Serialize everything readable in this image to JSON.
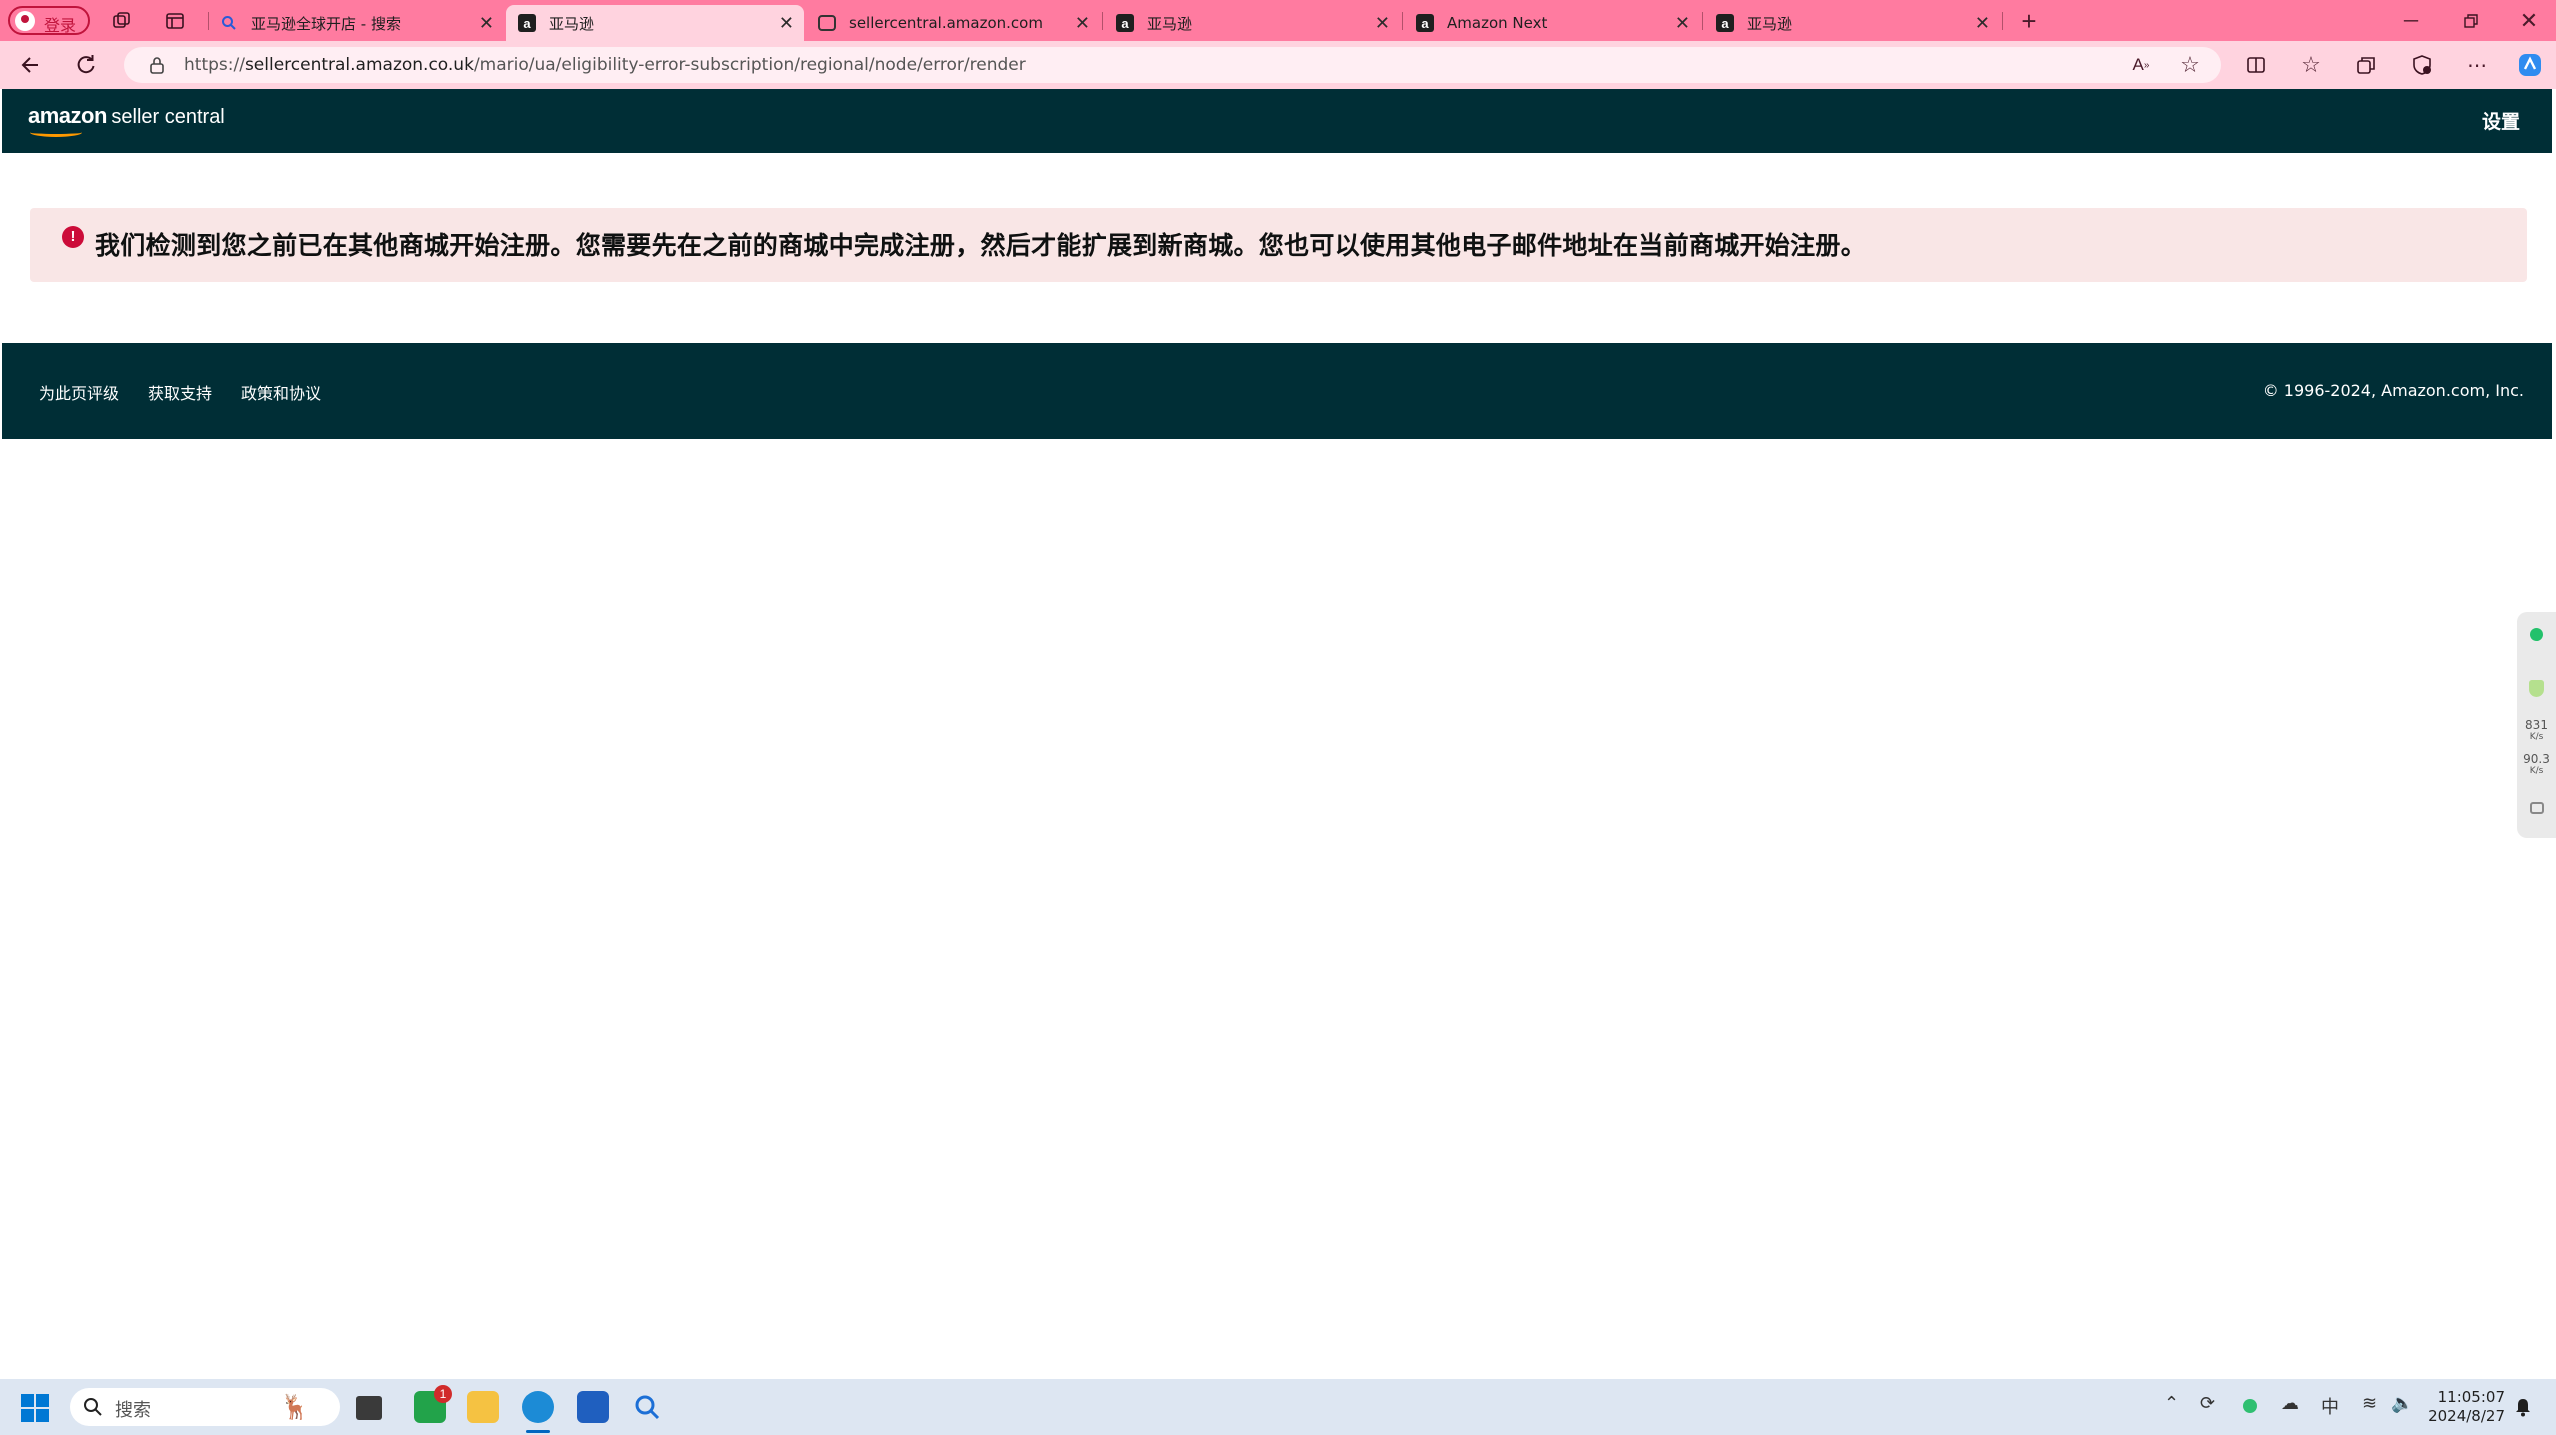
{
  "browser": {
    "profile_label": "登录",
    "tabs": [
      {
        "title": "亚马逊全球开店 - 搜索",
        "favicon": "search-icon",
        "active": false
      },
      {
        "title": "亚马逊",
        "favicon": "amazon-icon",
        "active": true
      },
      {
        "title": "sellercentral.amazon.com",
        "favicon": "sellercentral-icon",
        "active": false
      },
      {
        "title": "亚马逊",
        "favicon": "amazon-icon",
        "active": false
      },
      {
        "title": "Amazon Next",
        "favicon": "amazon-icon",
        "active": false
      },
      {
        "title": "亚马逊",
        "favicon": "amazon-icon",
        "active": false
      }
    ],
    "url_prefix": "https://",
    "url_host": "sellercentral.amazon.co.uk",
    "url_path": "/mario/ua/eligibility-error-subscription/regional/node/error/render",
    "accent_color": "#ff7ba0"
  },
  "header": {
    "logo_amazon": "amazon",
    "logo_seller_central": "seller central",
    "settings_label": "设置",
    "background_color": "#002e36"
  },
  "alert": {
    "icon": "!",
    "message": "我们检测到您之前已在其他商城开始注册。您需要先在之前的商城中完成注册，然后才能扩展到新商城。您也可以使用其他电子邮件地址在当前商城开始注册。",
    "background_color": "#f9e6e6",
    "icon_color": "#cc0c39"
  },
  "footer": {
    "links": [
      "为此页评级",
      "获取支持",
      "政策和协议"
    ],
    "copyright": "© 1996-2024, Amazon.com, Inc."
  },
  "side_widget": {
    "value_1": "831",
    "unit_1": "K/s",
    "value_2": "90.3",
    "unit_2": "K/s"
  },
  "taskbar": {
    "search_placeholder": "搜索",
    "badge_count": "1",
    "ime_label": "中",
    "time": "11:05:07",
    "date": "2024/8/27"
  }
}
